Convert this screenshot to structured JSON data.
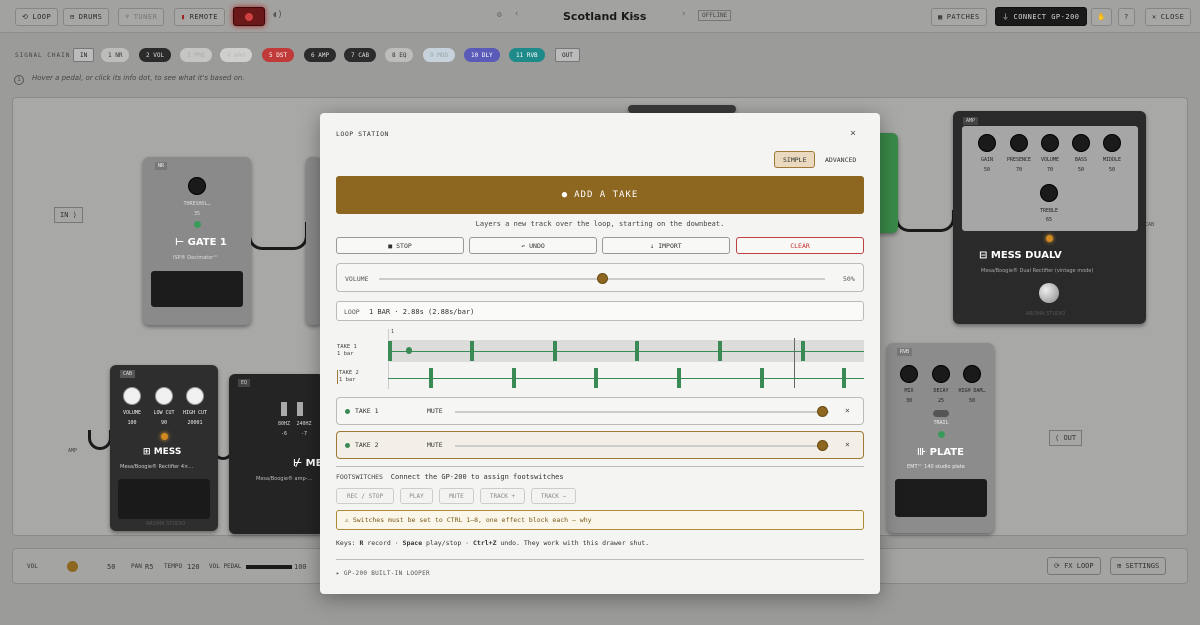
{
  "topbar": {
    "loop_label": "LOOP",
    "drums_label": "DRUMS",
    "tuner_label": "TUNER",
    "remote_label": "REMOTE",
    "patch_name": "Scotland Kiss",
    "offline_badge": "OFFLINE",
    "patches_label": "PATCHES",
    "connect_label": "CONNECT GP-200",
    "close_label": "CLOSE"
  },
  "chain": {
    "label": "SIGNAL CHAIN",
    "in_label": "IN",
    "out_label": "OUT",
    "blocks": [
      {
        "label": "1 NR",
        "bg": "#bdbdbb",
        "fg": "#333"
      },
      {
        "label": "2 VOL",
        "bg": "#2b2b2b",
        "fg": "#ddd"
      },
      {
        "label": "3 PRE",
        "bg": "#c5c5c3",
        "fg": "#aaa"
      },
      {
        "label": "4 WAH",
        "bg": "#cfcfcd",
        "fg": "#bbb"
      },
      {
        "label": "5 DST",
        "bg": "#c03a3a",
        "fg": "#fff"
      },
      {
        "label": "6 AMP",
        "bg": "#2b2b2b",
        "fg": "#ddd"
      },
      {
        "label": "7 CAB",
        "bg": "#2b2b2b",
        "fg": "#ddd"
      },
      {
        "label": "8 EQ",
        "bg": "#bdbdbb",
        "fg": "#333"
      },
      {
        "label": "9 MOD",
        "bg": "#c8d2dc",
        "fg": "#9aa"
      },
      {
        "label": "10 DLY",
        "bg": "#5a5ab8",
        "fg": "#fff"
      },
      {
        "label": "11 RVB",
        "bg": "#1f8a8a",
        "fg": "#fff"
      }
    ]
  },
  "hint": "Hover a pedal, or click its info dot, to see what it's based on.",
  "board": {
    "in_label": "IN",
    "out_label": "OUT",
    "amp_label": "AMP",
    "cab_label": "CAB",
    "gate": {
      "tag": "NR",
      "knob": "THRESHOL…",
      "value": "35",
      "name": "GATE 1",
      "sub": "ISP® Decimator™"
    },
    "amp": {
      "tag": "AMP",
      "name": "MESS DUALV",
      "sub": "Mesa/Boogie® Dual Rectifier (vintage mode)",
      "knobs": [
        {
          "l": "GAIN",
          "v": "50"
        },
        {
          "l": "PRESENCE",
          "v": "70"
        },
        {
          "l": "VOLUME",
          "v": "70"
        },
        {
          "l": "BASS",
          "v": "50"
        },
        {
          "l": "MIDDLE",
          "v": "50"
        }
      ],
      "treble_label": "TREBLE",
      "treble_value": "65",
      "brand": "AROMA STUDIO"
    },
    "cab": {
      "tag": "CAB",
      "name": "MESS",
      "sub": "Mesa/Boogie® Rectifier 4×…",
      "brand": "AROMA STUDIO",
      "knobs": [
        {
          "l": "VOLUME",
          "v": "100"
        },
        {
          "l": "LOW CUT",
          "v": "90"
        },
        {
          "l": "HIGH CUT",
          "v": "20001"
        }
      ]
    },
    "eq": {
      "tag": "EQ",
      "name": "ME",
      "sub": "Mesa/Boogie® amp-…",
      "bands": [
        {
          "l": "80HZ",
          "v": "-6"
        },
        {
          "l": "240HZ",
          "v": "-7"
        }
      ]
    },
    "plate": {
      "tag": "RVB",
      "name": "PLATE",
      "sub": "EMT™ 140 studio plate",
      "knobs": [
        {
          "l": "MIX",
          "v": "30"
        },
        {
          "l": "DECAY",
          "v": "25"
        },
        {
          "l": "HIGH DAM…",
          "v": "50"
        }
      ],
      "trail": "TRAIL"
    }
  },
  "bottom": {
    "vol_label": "VOL",
    "vol_value": "50",
    "pan_label": "PAN",
    "pan_value": "R5",
    "tempo_label": "TEMPO",
    "tempo_value": "120",
    "volpedal_label": "VOL PEDAL",
    "volpedal_value": "100",
    "fxloop_label": "FX LOOP",
    "settings_label": "SETTINGS"
  },
  "modal": {
    "title": "LOOP STATION",
    "close": "×",
    "simple": "SIMPLE",
    "advanced": "ADVANCED",
    "add_take": "ADD A TAKE",
    "add_hint": "Layers a new track over the loop, starting on the downbeat.",
    "stop": "STOP",
    "undo": "UNDO",
    "import": "IMPORT",
    "clear": "CLEAR",
    "volume_label": "VOLUME",
    "volume_value": "50%",
    "volume_level": 0.5,
    "loop_label": "LOOP",
    "loop_info": "1 BAR · 2.88s (2.88s/bar)",
    "ruler_mark": "1",
    "take1_label": "TAKE 1",
    "take1_sub": "1 bar",
    "take2_label": "TAKE 2",
    "take2_sub": "1 bar",
    "tracks": [
      {
        "name": "TAKE 1",
        "mute": "MUTE",
        "level": 0.98,
        "x": "×"
      },
      {
        "name": "TAKE 2",
        "mute": "MUTE",
        "level": 0.98,
        "x": "×"
      }
    ],
    "footswitches_label": "FOOTSWITCHES",
    "footswitches_hint": "Connect the GP-200 to assign footswitches",
    "fs_buttons": [
      "REC / STOP",
      "PLAY",
      "MUTE",
      "TRACK +",
      "TRACK −"
    ],
    "warning": "⚠ Switches must be set to CTRL 1–8, one effect block each — why",
    "keys_prefix": "Keys: ",
    "key_r": "R",
    "keys_r_text": " record · ",
    "key_space": "Space",
    "keys_space_text": " play/stop · ",
    "key_undo": "Ctrl+Z",
    "keys_suffix": " undo. They work with this drawer shut.",
    "builtin": "▸ GP-200 BUILT-IN LOOPER"
  }
}
